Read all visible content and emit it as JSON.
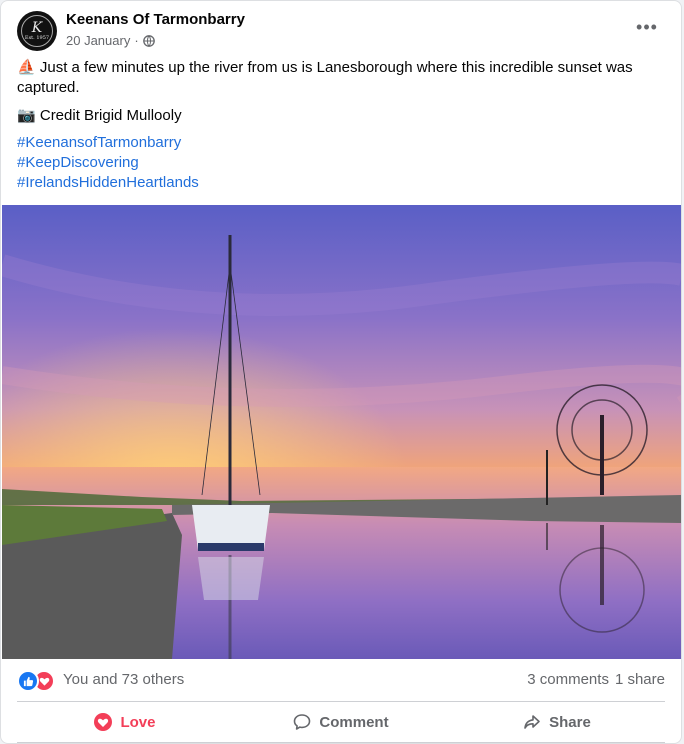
{
  "post": {
    "page_name": "Keenans Of Tarmonbarry",
    "date": "20 January",
    "separator": "·",
    "privacy_icon": "globe-icon",
    "more_label": "•••",
    "avatar": {
      "letter": "K",
      "subtext": "Est. 1957"
    },
    "body": {
      "line1_emoji": "⛵",
      "line1": "Just a few minutes up the river from us is Lanesborough where this incredible sunset was captured.",
      "line2_emoji": "📷",
      "line2": "Credit Brigid Mullooly"
    },
    "hashtags": [
      "#KeenansofTarmonbarry",
      "#KeepDiscovering",
      "#IrelandsHiddenHeartlands"
    ]
  },
  "engagement": {
    "reactions_text": "You and 73 others",
    "comments": "3 comments",
    "shares": "1 share"
  },
  "actions": {
    "love": "Love",
    "comment": "Comment",
    "share": "Share"
  },
  "colors": {
    "link": "#216fdb",
    "love": "#f33e58",
    "like": "#1877f2",
    "muted": "#65676b"
  }
}
